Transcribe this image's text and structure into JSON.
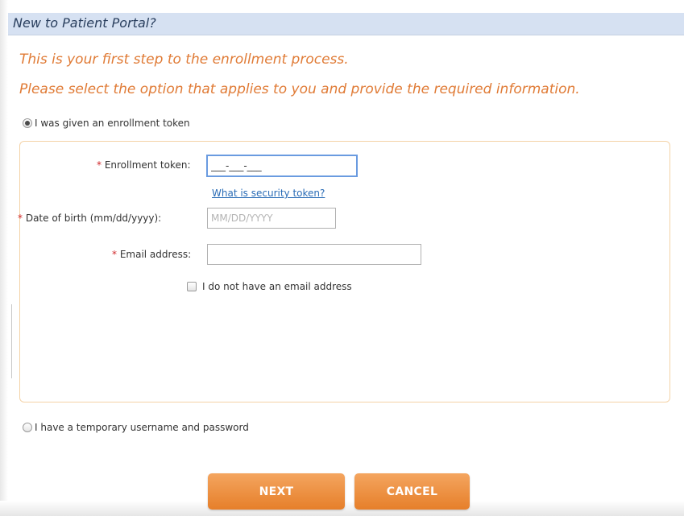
{
  "header": {
    "title": "New to Patient Portal?"
  },
  "intro": {
    "line1": "This is your first step to the enrollment process.",
    "line2": "Please select the option that applies to you and provide the required information."
  },
  "options": {
    "token_option": {
      "label": "I was given an enrollment token",
      "selected": true
    },
    "temp_option": {
      "label": "I have a temporary username and password",
      "selected": false
    }
  },
  "form": {
    "required_marker": "*",
    "enrollment_token": {
      "label": "Enrollment token:",
      "value": "___-___-___"
    },
    "security_link": "What is security token?",
    "date_of_birth": {
      "label": "Date of birth (mm/dd/yyyy):",
      "placeholder": "MM/DD/YYYY",
      "value": ""
    },
    "email": {
      "label": "Email address:",
      "value": ""
    },
    "no_email_checkbox": {
      "label": "I do not have an email address",
      "checked": false
    }
  },
  "buttons": {
    "next": "NEXT",
    "cancel": "CANCEL"
  },
  "colors": {
    "accent": "#E67F2A",
    "header_bg": "#D6E1F2",
    "intro_text": "#E07B36",
    "link": "#2A6CB6",
    "required": "#D0282B"
  }
}
